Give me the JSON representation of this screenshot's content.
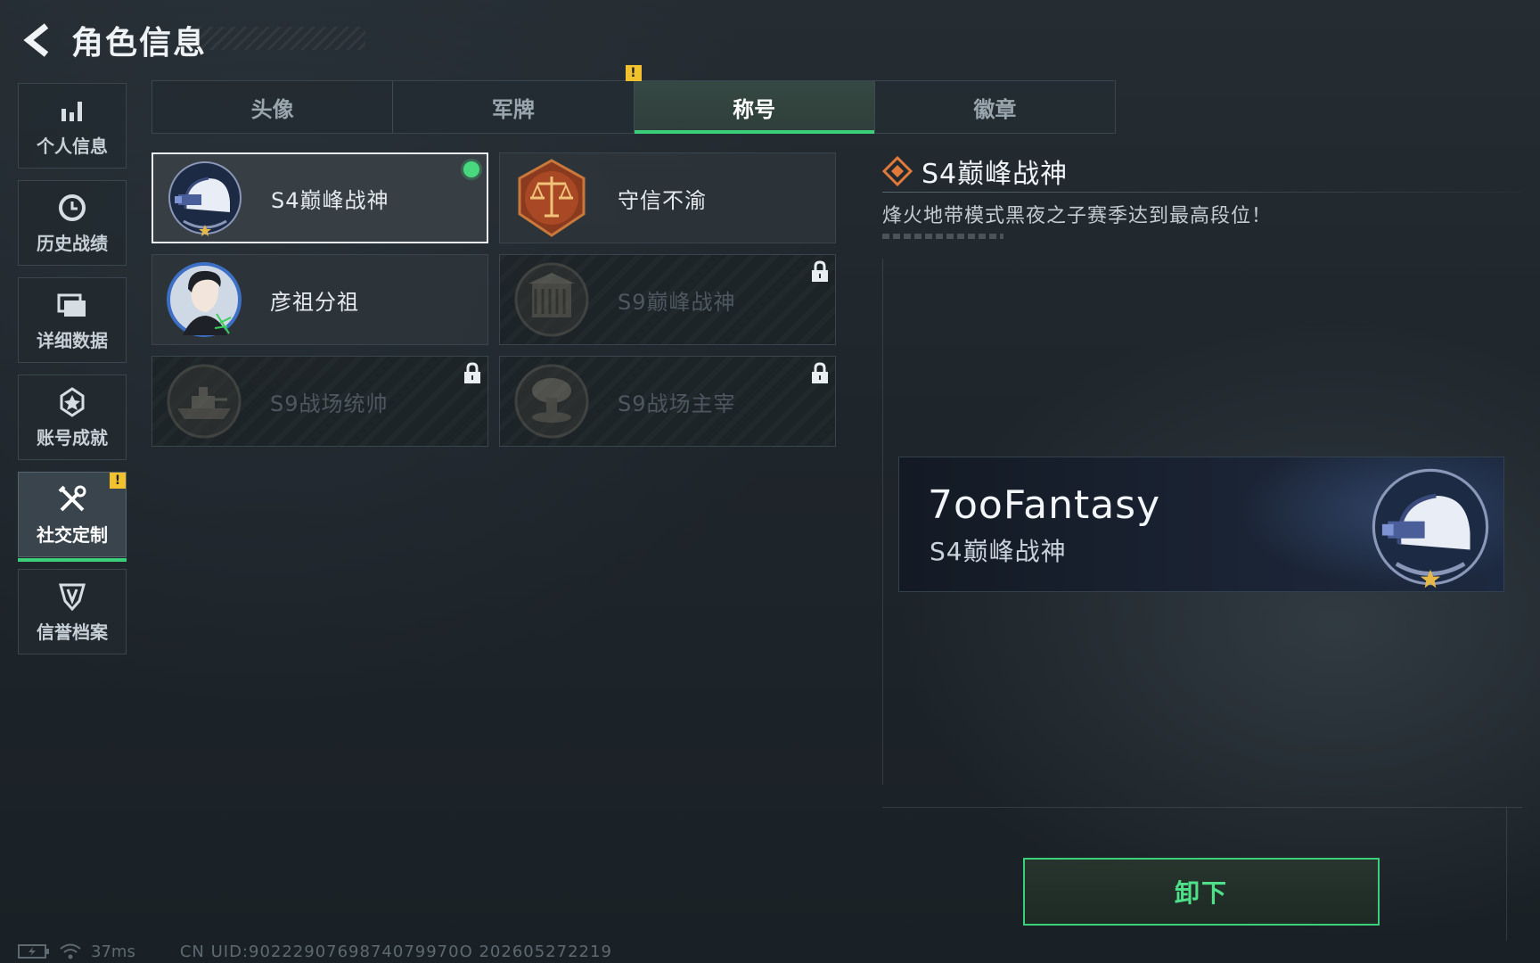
{
  "header": {
    "title": "角色信息"
  },
  "sidebar": {
    "items": [
      {
        "label": "个人信息",
        "icon": "bar-chart-icon"
      },
      {
        "label": "历史战绩",
        "icon": "clock-icon"
      },
      {
        "label": "详细数据",
        "icon": "folder-icon"
      },
      {
        "label": "账号成就",
        "icon": "medal-icon"
      },
      {
        "label": "社交定制",
        "icon": "tools-icon",
        "active": true,
        "badge": "!"
      },
      {
        "label": "信誉档案",
        "icon": "shield-icon"
      }
    ]
  },
  "tabs": {
    "items": [
      {
        "label": "头像"
      },
      {
        "label": "军牌",
        "badge": "!"
      },
      {
        "label": "称号",
        "active": true
      },
      {
        "label": "徽章"
      }
    ]
  },
  "titles": {
    "items": [
      {
        "label": "S4巅峰战神",
        "state": "equipped",
        "icon": "helmet-emblem-icon"
      },
      {
        "label": "守信不渝",
        "state": "owned",
        "icon": "scales-emblem-icon"
      },
      {
        "label": "彦祖分祖",
        "state": "owned",
        "icon": "portrait-emblem-icon"
      },
      {
        "label": "S9巅峰战神",
        "state": "locked",
        "icon": "building-emblem-icon"
      },
      {
        "label": "S9战场统帅",
        "state": "locked",
        "icon": "warship-emblem-icon"
      },
      {
        "label": "S9战场主宰",
        "state": "locked",
        "icon": "mushroom-cloud-emblem-icon"
      }
    ]
  },
  "detail": {
    "title": "S4巅峰战神",
    "description": "烽火地带模式黑夜之子赛季达到最高段位！",
    "preview": {
      "player_name": "7ooFantasy",
      "title": "S4巅峰战神"
    },
    "unequip_label": "卸下"
  },
  "status": {
    "ping": "37ms",
    "uid": "CN UID:9022290769874079970O 202605272219"
  },
  "colors": {
    "accent_green": "#3ccf7a",
    "warning_yellow": "#f2c12e",
    "background": "#1c2329"
  }
}
